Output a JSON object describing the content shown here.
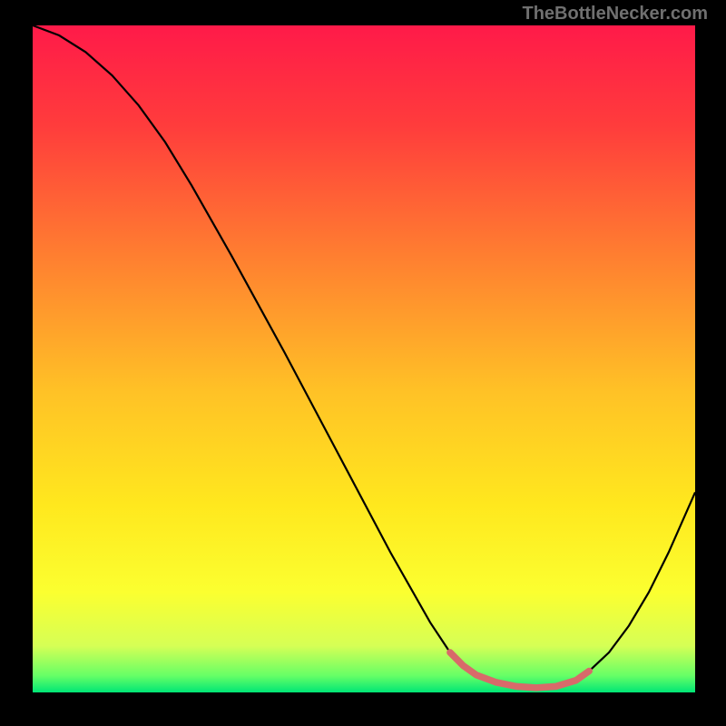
{
  "watermark": "TheBottleNecker.com",
  "chart_data": {
    "type": "line",
    "title": "",
    "xlabel": "",
    "ylabel": "",
    "xlim": [
      0,
      100
    ],
    "ylim": [
      0,
      100
    ],
    "gradient_stops": [
      {
        "offset": 0.0,
        "color": "#ff1a49"
      },
      {
        "offset": 0.15,
        "color": "#ff3c3c"
      },
      {
        "offset": 0.35,
        "color": "#ff8030"
      },
      {
        "offset": 0.55,
        "color": "#ffc226"
      },
      {
        "offset": 0.72,
        "color": "#ffe81e"
      },
      {
        "offset": 0.85,
        "color": "#fbff30"
      },
      {
        "offset": 0.93,
        "color": "#d6ff55"
      },
      {
        "offset": 0.975,
        "color": "#66ff66"
      },
      {
        "offset": 1.0,
        "color": "#00e676"
      }
    ],
    "series": [
      {
        "name": "curve",
        "stroke": "#000000",
        "stroke_width": 2.2,
        "x": [
          0,
          4,
          8,
          12,
          16,
          20,
          24,
          30,
          38,
          46,
          54,
          60,
          63,
          65,
          67,
          70,
          73,
          76,
          79,
          82,
          84,
          87,
          90,
          93,
          96,
          100
        ],
        "y": [
          100,
          98.5,
          96,
          92.5,
          88,
          82.5,
          76,
          65.5,
          51,
          36,
          21,
          10.5,
          6,
          4,
          2.6,
          1.5,
          0.9,
          0.7,
          0.9,
          1.8,
          3.2,
          6,
          10,
          15,
          21,
          30
        ]
      },
      {
        "name": "bottom-highlight",
        "stroke": "#d86a6a",
        "stroke_width": 7.5,
        "linecap": "round",
        "x": [
          63,
          65,
          67,
          70,
          73,
          76,
          79,
          82,
          84
        ],
        "y": [
          6,
          4,
          2.6,
          1.5,
          0.9,
          0.7,
          0.9,
          1.8,
          3.2
        ]
      }
    ]
  }
}
